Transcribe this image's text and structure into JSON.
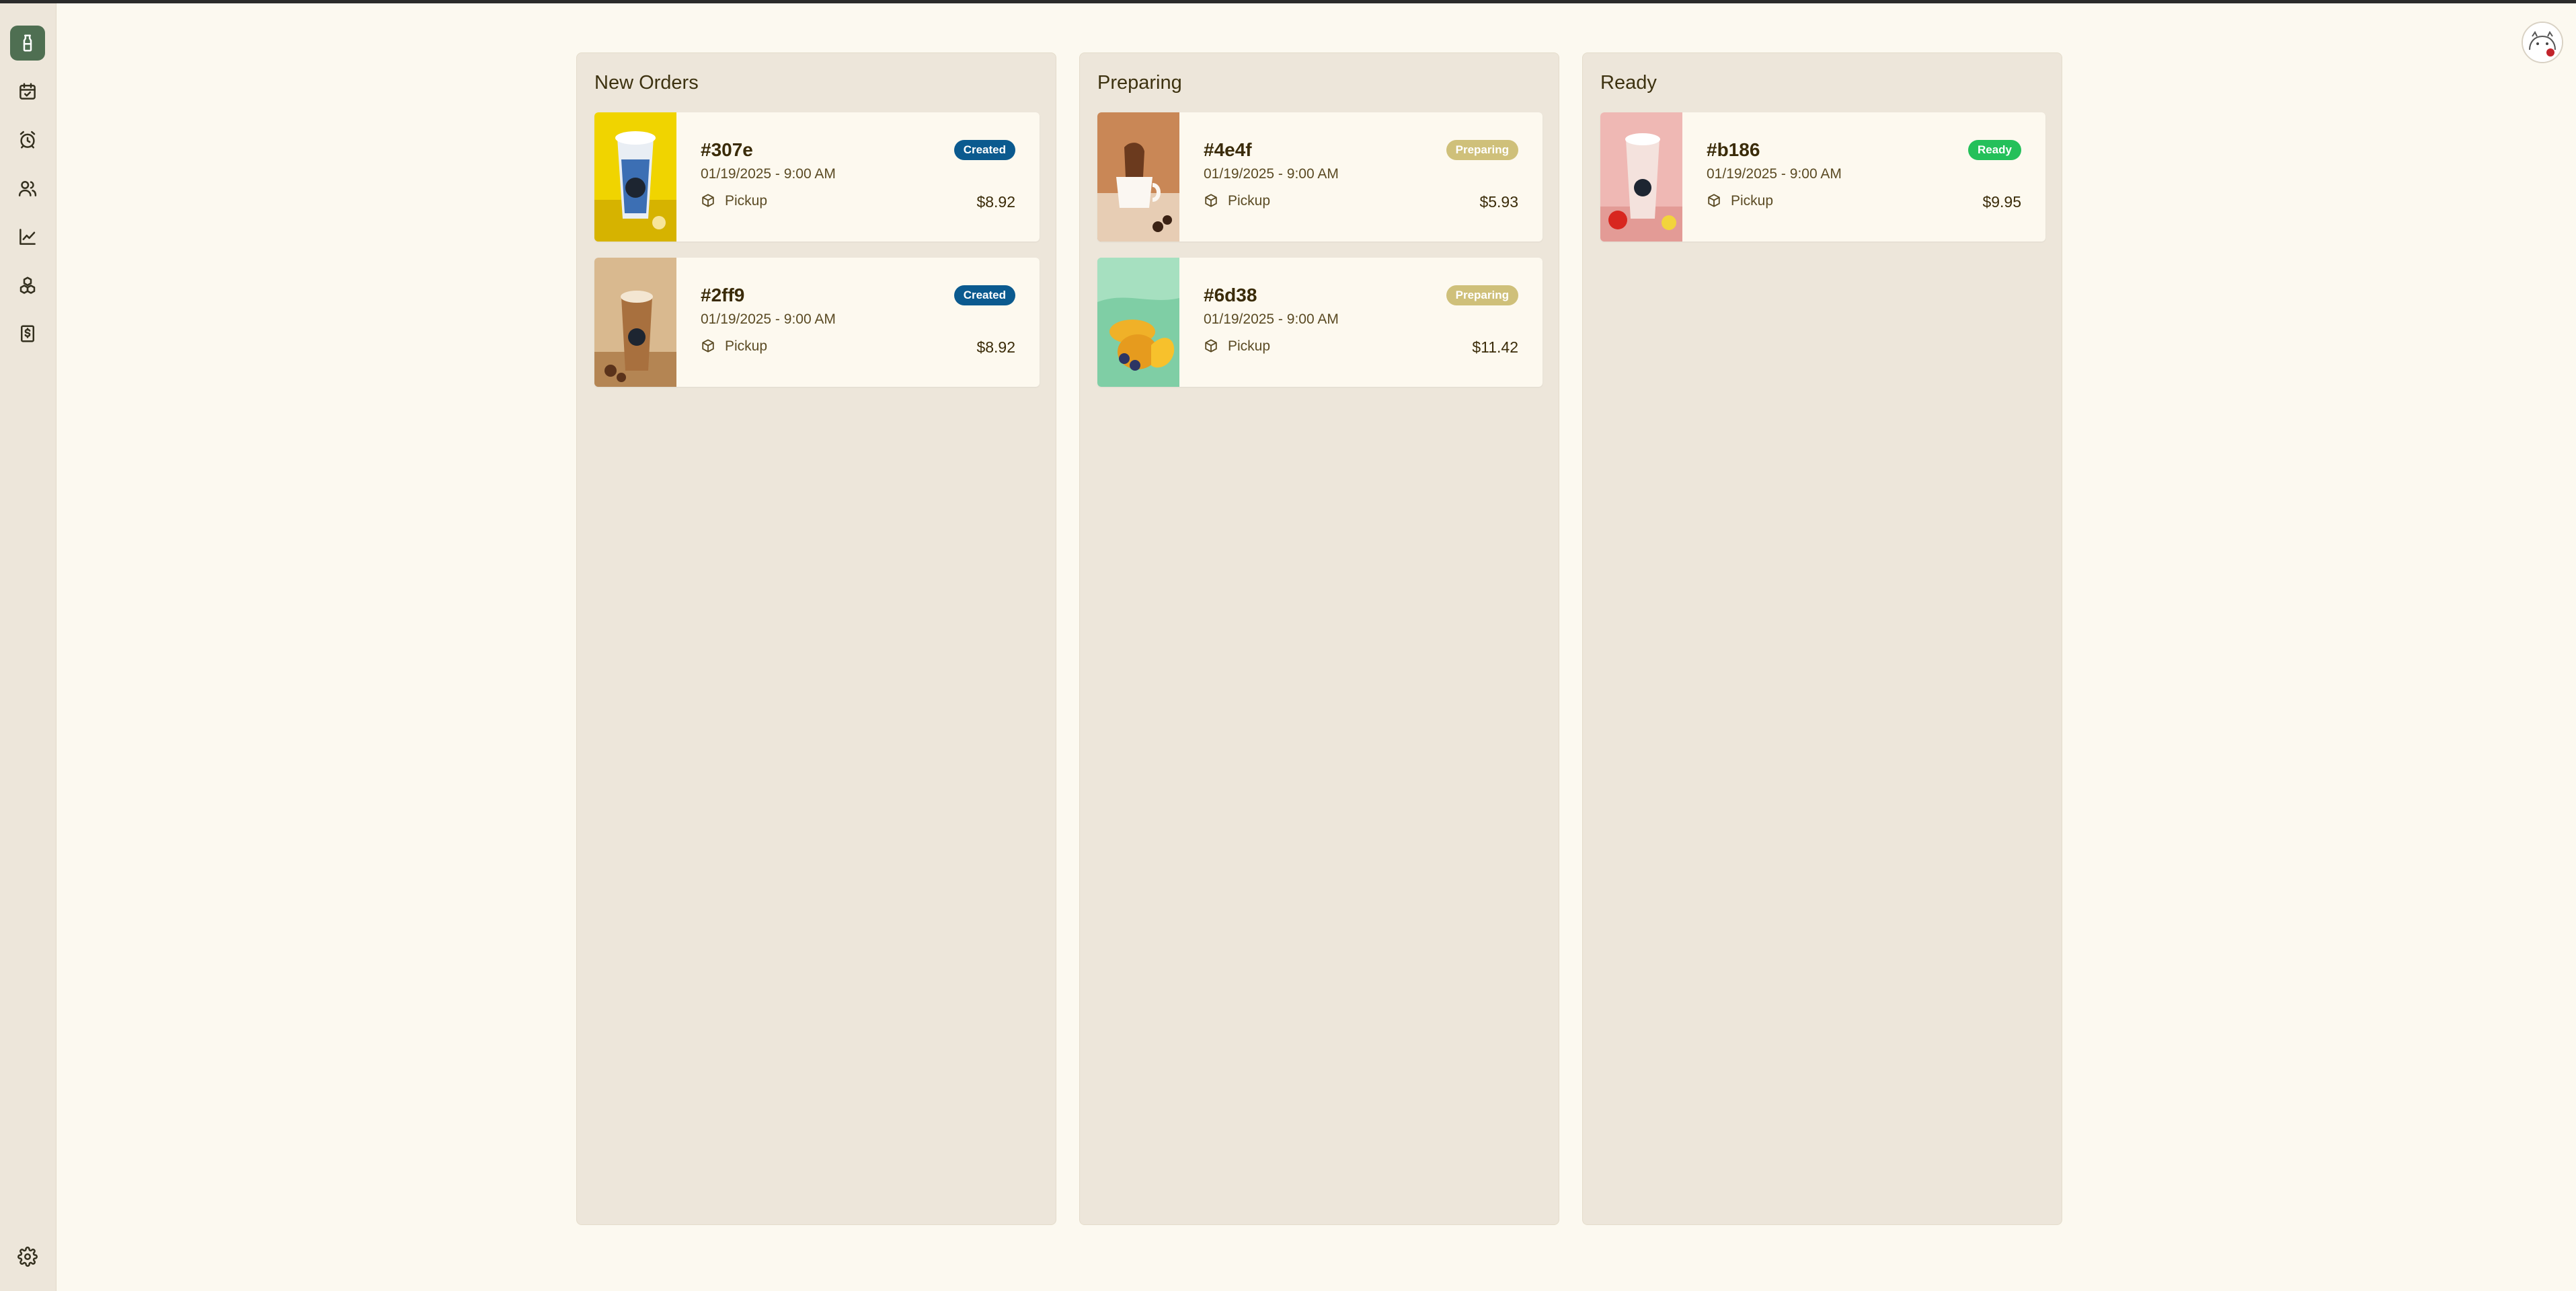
{
  "sidebar": {
    "items": [
      {
        "name": "sidebar-item-orders",
        "icon": "cup-icon",
        "active": true
      },
      {
        "name": "sidebar-item-calendar",
        "icon": "calendar-check-icon",
        "active": false
      },
      {
        "name": "sidebar-item-alarms",
        "icon": "alarm-clock-icon",
        "active": false
      },
      {
        "name": "sidebar-item-customers",
        "icon": "users-icon",
        "active": false
      },
      {
        "name": "sidebar-item-analytics",
        "icon": "line-chart-icon",
        "active": false
      },
      {
        "name": "sidebar-item-inventory",
        "icon": "boxes-icon",
        "active": false
      },
      {
        "name": "sidebar-item-billing",
        "icon": "dollar-receipt-icon",
        "active": false
      }
    ],
    "settings_icon": "gear-icon"
  },
  "colors": {
    "created": "#0b5a8f",
    "preparing": "#cfc07a",
    "ready": "#24c05a",
    "sidebar_active": "#4f6f52",
    "background": "#fcf9f0",
    "column": "#ede6da"
  },
  "columns": [
    {
      "title": "New Orders",
      "orders": [
        {
          "id": "#307e",
          "date": "01/19/2025 - 9:00 AM",
          "fulfillment": "Pickup",
          "price": "$8.92",
          "status": "Created",
          "image": "yellow-drink"
        },
        {
          "id": "#2ff9",
          "date": "01/19/2025 - 9:00 AM",
          "fulfillment": "Pickup",
          "price": "$8.92",
          "status": "Created",
          "image": "coffee-frappe"
        }
      ]
    },
    {
      "title": "Preparing",
      "orders": [
        {
          "id": "#4e4f",
          "date": "01/19/2025 - 9:00 AM",
          "fulfillment": "Pickup",
          "price": "$5.93",
          "status": "Preparing",
          "image": "coffee-cup"
        },
        {
          "id": "#6d38",
          "date": "01/19/2025 - 9:00 AM",
          "fulfillment": "Pickup",
          "price": "$11.42",
          "status": "Preparing",
          "image": "fruit-bowl"
        }
      ]
    },
    {
      "title": "Ready",
      "orders": [
        {
          "id": "#b186",
          "date": "01/19/2025 - 9:00 AM",
          "fulfillment": "Pickup",
          "price": "$9.95",
          "status": "Ready",
          "image": "pink-smoothie"
        }
      ]
    }
  ]
}
